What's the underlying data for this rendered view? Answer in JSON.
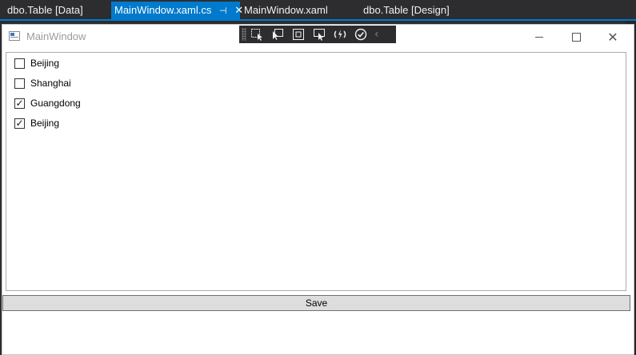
{
  "ide": {
    "tabs": [
      {
        "label": "dbo.Table [Data]",
        "active": false
      },
      {
        "label": "MainWindow.xaml.cs",
        "active": true,
        "pin_icon": "pin-icon",
        "close_icon": "close-icon"
      },
      {
        "label": "MainWindow.xaml",
        "active": false
      },
      {
        "label": "dbo.Table [Design]",
        "active": false
      }
    ],
    "accent": "#007acc",
    "background": "#2d2d30"
  },
  "window": {
    "title": "MainWindow",
    "controls": [
      "minimize-icon",
      "maximize-icon",
      "close-icon"
    ]
  },
  "debug_toolbar": {
    "buttons": [
      "select-element-icon",
      "display-layout-adorners-icon",
      "track-focus-icon",
      "preview-selection-icon",
      "hot-reload-icon",
      "accessibility-check-icon"
    ],
    "chevron": "‹"
  },
  "checkboxes": [
    {
      "label": "Beijing",
      "checked": false
    },
    {
      "label": "Shanghai",
      "checked": false
    },
    {
      "label": "Guangdong",
      "checked": true
    },
    {
      "label": "Beijing",
      "checked": true
    }
  ],
  "save_button": {
    "label": "Save"
  }
}
